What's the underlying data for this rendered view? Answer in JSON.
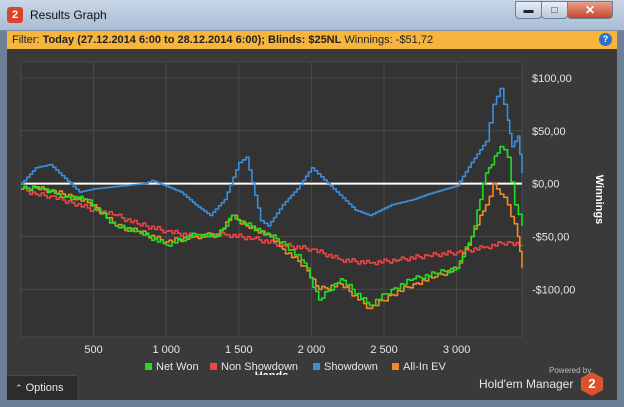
{
  "window": {
    "title": "Results Graph",
    "app_icon_text": "2"
  },
  "filter": {
    "label": "Filter:",
    "range": "Today (27.12.2014 6:00 to 28.12.2014 6:00);",
    "blinds": "Blinds: $25NL",
    "winnings_label": "Winnings:",
    "winnings_value": "-$51,72"
  },
  "options_label": "Options",
  "branding": {
    "powered_by": "Powered by",
    "name": "Hold'em Manager",
    "logo_text": "2"
  },
  "colors": {
    "net_won": "#22dd22",
    "non_showdown": "#ee4444",
    "showdown": "#3a8fdd",
    "all_in_ev": "#f08a26",
    "zero_line": "#ffffff"
  },
  "chart_data": {
    "type": "line",
    "xlabel": "Hands",
    "ylabel": "Winnings",
    "xlim": [
      0,
      3450
    ],
    "ylim": [
      -145,
      115
    ],
    "x_ticks": [
      500,
      1000,
      1500,
      2000,
      2500,
      3000
    ],
    "x_tick_labels": [
      "500",
      "1 000",
      "1 500",
      "2 000",
      "2 500",
      "3 000"
    ],
    "y_ticks": [
      100,
      50,
      0,
      -50,
      -100
    ],
    "y_tick_labels": [
      "$100,00",
      "$50,00",
      "$0,00",
      "-$50,00",
      "-$100,00"
    ],
    "legend_position": "bottom",
    "series": [
      {
        "name": "Net Won",
        "color": "#22dd22",
        "x": [
          0,
          100,
          150,
          250,
          300,
          450,
          650,
          800,
          1000,
          1200,
          1350,
          1450,
          1500,
          1650,
          1800,
          1950,
          2050,
          2200,
          2400,
          2550,
          2700,
          2850,
          3000,
          3100,
          3200,
          3300,
          3350,
          3400,
          3450
        ],
        "y": [
          -5,
          -3,
          -5,
          -10,
          -12,
          -15,
          -40,
          -45,
          -58,
          -48,
          -50,
          -30,
          -35,
          -45,
          -55,
          -75,
          -110,
          -90,
          -115,
          -100,
          -90,
          -85,
          -80,
          -50,
          10,
          35,
          25,
          -20,
          -40
        ]
      },
      {
        "name": "Non Showdown",
        "color": "#ee4444",
        "x": [
          0,
          100,
          200,
          350,
          500,
          650,
          800,
          1000,
          1200,
          1400,
          1600,
          1800,
          2000,
          2200,
          2400,
          2600,
          2800,
          3000,
          3200,
          3350,
          3450
        ],
        "y": [
          -5,
          -10,
          -12,
          -18,
          -25,
          -30,
          -38,
          -45,
          -50,
          -48,
          -52,
          -58,
          -62,
          -72,
          -75,
          -72,
          -68,
          -65,
          -60,
          -55,
          -58
        ]
      },
      {
        "name": "Showdown",
        "color": "#3a8fdd",
        "x": [
          0,
          100,
          200,
          300,
          400,
          500,
          700,
          850,
          900,
          1100,
          1200,
          1300,
          1400,
          1500,
          1550,
          1650,
          1700,
          1800,
          1900,
          2000,
          2150,
          2300,
          2400,
          2550,
          2700,
          2800,
          3000,
          3100,
          3200,
          3250,
          3300,
          3350,
          3380,
          3420,
          3450
        ],
        "y": [
          0,
          15,
          18,
          5,
          -8,
          -5,
          -2,
          0,
          3,
          -8,
          -20,
          -30,
          -15,
          20,
          25,
          -35,
          -40,
          -20,
          -5,
          15,
          -5,
          -25,
          -30,
          -20,
          -15,
          -10,
          -2,
          20,
          40,
          75,
          90,
          60,
          35,
          45,
          10
        ]
      },
      {
        "name": "All-In EV",
        "color": "#f08a26",
        "x": [
          0,
          100,
          200,
          350,
          500,
          650,
          800,
          1000,
          1200,
          1350,
          1450,
          1550,
          1700,
          1800,
          1950,
          2050,
          2200,
          2400,
          2550,
          2700,
          2850,
          3000,
          3100,
          3200,
          3250,
          3300,
          3350,
          3420,
          3450
        ],
        "y": [
          -5,
          -4,
          -7,
          -12,
          -20,
          -40,
          -45,
          -55,
          -50,
          -48,
          -30,
          -40,
          -48,
          -62,
          -78,
          -100,
          -95,
          -118,
          -105,
          -95,
          -88,
          -80,
          -50,
          -20,
          0,
          -10,
          -20,
          -50,
          -80
        ]
      }
    ]
  }
}
